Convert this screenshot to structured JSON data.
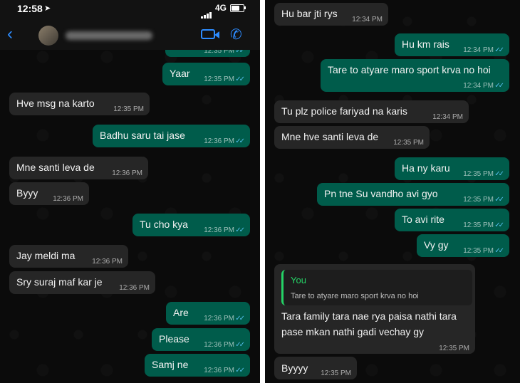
{
  "status_bar": {
    "time": "12:58",
    "network": "4G",
    "battery_level": 0.7
  },
  "header": {
    "contact_name_blurred": true
  },
  "left_messages": [
    {
      "dir": "out",
      "text": "",
      "time": "12:35 PM"
    },
    {
      "dir": "out",
      "text": "Yaar",
      "time": "12:35 PM"
    },
    {
      "dir": "in",
      "text": "Hve msg na karto",
      "time": "12:35 PM"
    },
    {
      "dir": "out",
      "text": "Badhu saru tai jase",
      "time": "12:36 PM"
    },
    {
      "dir": "in",
      "text": "Mne santi leva de",
      "time": "12:36 PM"
    },
    {
      "dir": "in",
      "text": "Byyy",
      "time": "12:36 PM"
    },
    {
      "dir": "out",
      "text": "Tu cho kya",
      "time": "12:36 PM"
    },
    {
      "dir": "in",
      "text": "Jay meldi ma",
      "time": "12:36 PM"
    },
    {
      "dir": "in",
      "text": "Sry suraj maf kar je",
      "time": "12:36 PM"
    },
    {
      "dir": "out",
      "text": "Are",
      "time": "12:36 PM"
    },
    {
      "dir": "out",
      "text": "Please",
      "time": "12:36 PM"
    },
    {
      "dir": "out",
      "text": "Samj ne",
      "time": "12:36 PM"
    }
  ],
  "right_messages": [
    {
      "dir": "in",
      "text": "Hu bar jti rys",
      "time": "12:34 PM"
    },
    {
      "dir": "out",
      "text": "Hu km rais",
      "time": "12:34 PM"
    },
    {
      "dir": "out",
      "text": "Tare to atyare maro sport krva no hoi",
      "time": "12:34 PM"
    },
    {
      "dir": "in",
      "text": "Tu plz police fariyad na karis",
      "time": "12:34 PM"
    },
    {
      "dir": "in",
      "text": "Mne hve santi leva de",
      "time": "12:35 PM"
    },
    {
      "dir": "out",
      "text": "Ha ny karu",
      "time": "12:35 PM"
    },
    {
      "dir": "out",
      "text": "Pn tne Su vandho avi gyo",
      "time": "12:35 PM"
    },
    {
      "dir": "out",
      "text": "To avi rite",
      "time": "12:35 PM"
    },
    {
      "dir": "out",
      "text": "Vy gy",
      "time": "12:35 PM"
    }
  ],
  "reply_message": {
    "quote_author": "You",
    "quote_text": "Tare to atyare maro sport krva no hoi",
    "line1": "Tara family tara nae rya paisa nathi tara",
    "line2": "pase mkan nathi gadi vechay gy",
    "time": "12:35 PM"
  },
  "last_message": {
    "text": "Byyyy",
    "time": "12:35 PM"
  },
  "colors": {
    "incoming": "#262626",
    "outgoing": "#005c4b",
    "read_ticks": "#53bdeb",
    "accent": "#2d8cff"
  }
}
